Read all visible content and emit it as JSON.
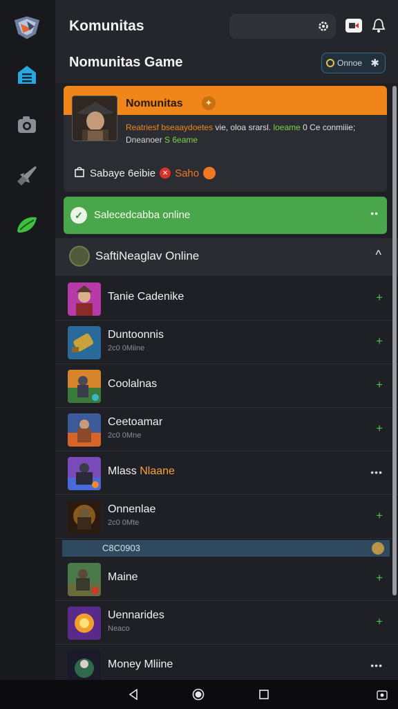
{
  "header": {
    "app_title": "Komunitas",
    "page_title": "Nomunitas Game",
    "online_pill_label": "Onnoe",
    "search_placeholder": ""
  },
  "featured": {
    "name": "Nomunitas",
    "desc_part1": "Reatriesf bseaaydoetes",
    "desc_part2": " vie, oloa srarsl. ",
    "desc_part3": "loeame",
    "desc_part4": " 0 Ce conmiiie;",
    "sub_part1": "Dneanoer ",
    "sub_part2": "S 6eame",
    "bottom_label": "Sabaye 6eibie",
    "bottom_link": "Saho"
  },
  "selection": {
    "label": "Salecedcabba online",
    "more": "••"
  },
  "section": {
    "title": "SaftiNeaglav Online",
    "caret": "^"
  },
  "rows": [
    {
      "name": "Tanie Cadenike",
      "status": "",
      "action": "+"
    },
    {
      "name": "Duntoonnis",
      "status": "2c0 0Miine",
      "action": "+"
    },
    {
      "name": "Coolalnas",
      "status": "",
      "action": "+"
    },
    {
      "name": "Ceetoamar",
      "status": "2c0 0Mne",
      "action": "+"
    },
    {
      "name_a": "Mlass ",
      "name_b": "Nlaane",
      "status": "",
      "action": "•••"
    },
    {
      "name": "Onnenlae",
      "status": "2c0 0Mte",
      "action": "+"
    },
    {
      "name": "Maine",
      "status": "",
      "action": "+"
    },
    {
      "name": "Uennarides",
      "status": "Neaco",
      "action": "+"
    },
    {
      "name": "Money Mliine",
      "status": "",
      "action": "•••"
    }
  ],
  "divider": {
    "label": "C8C0903"
  },
  "colors": {
    "accent_orange": "#f0861a",
    "accent_green": "#4aa64a",
    "rail_active": "#2aa7e0",
    "rail_green": "#3fbf3f"
  },
  "icons": [
    "logo-icon",
    "home-icon",
    "camera-icon",
    "rocket-icon",
    "leaf-icon",
    "gear-icon",
    "video-icon",
    "bell-icon"
  ]
}
